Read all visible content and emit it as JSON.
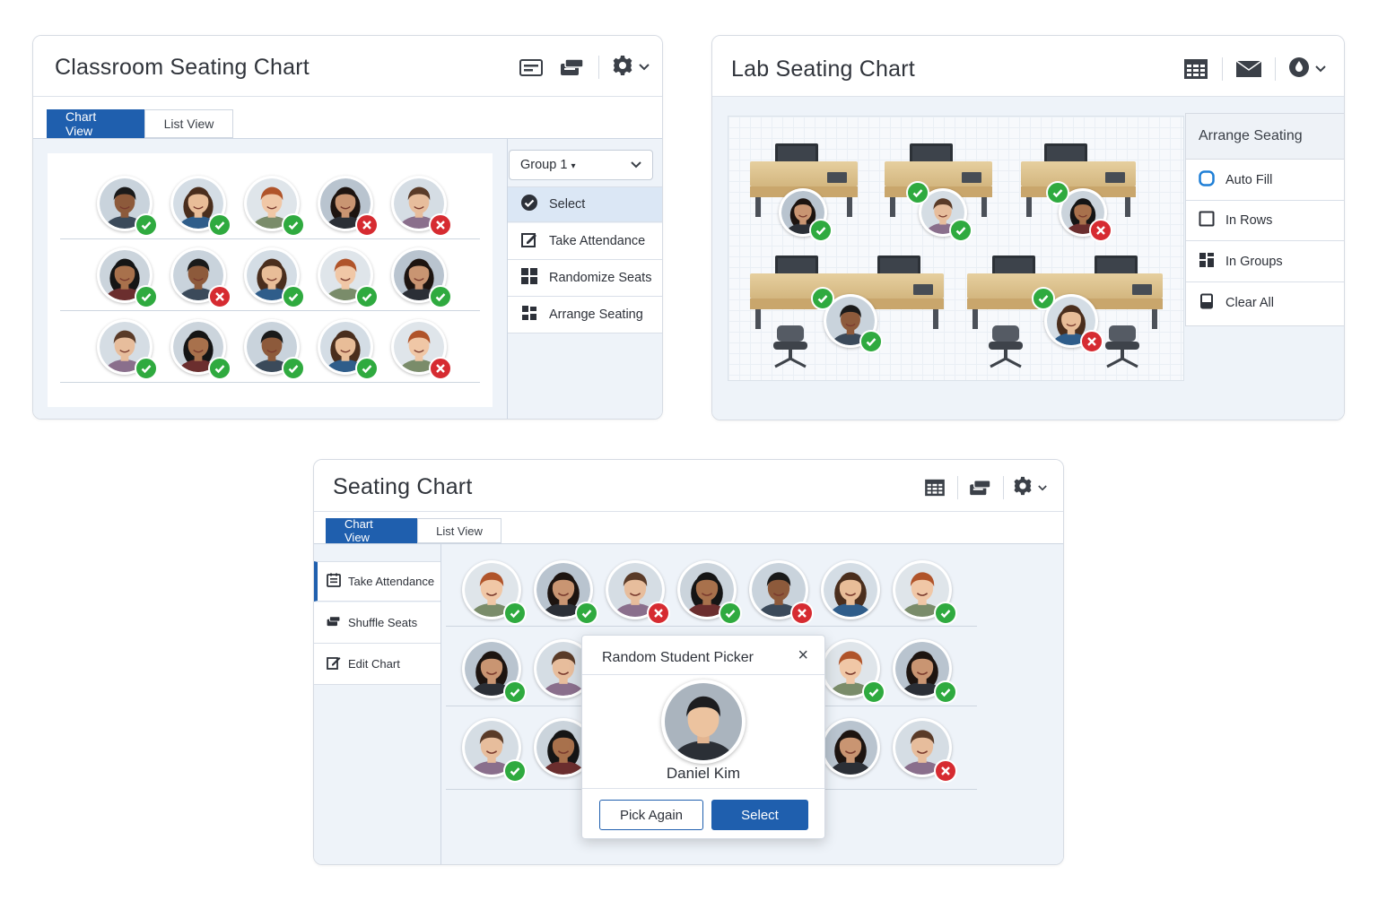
{
  "classroom": {
    "title": "Classroom Seating Chart",
    "icons": [
      "seating-chart-icon",
      "shuffle-icon",
      "gear-icon",
      "chevron-down-icon"
    ],
    "tabs": [
      "Chart View",
      "List View"
    ],
    "active_tab": "Chart View",
    "dropdown": "Group 1",
    "menu": [
      {
        "label": "Select",
        "icon": "check-circle-icon"
      },
      {
        "label": "Take Attendance",
        "icon": "attendance-edit-icon"
      },
      {
        "label": "Randomize Seats",
        "icon": "grid-icon"
      },
      {
        "label": "Arrange Seating",
        "icon": "arrange-icon"
      }
    ],
    "seats": [
      [
        "ok",
        "ok",
        "ok",
        "no",
        "no"
      ],
      [
        "ok",
        "no",
        "ok",
        "ok",
        "ok"
      ],
      [
        "ok",
        "ok",
        "ok",
        "ok",
        "no"
      ]
    ]
  },
  "lab": {
    "title": "Lab Seating Chart",
    "icons": [
      "table-icon",
      "mail-icon",
      "drop-icon",
      "chevron-down-icon"
    ],
    "arrange": {
      "heading": "Arrange Seating",
      "options": [
        {
          "label": "Auto Fill",
          "icon": "radio-icon"
        },
        {
          "label": "In Rows",
          "icon": "checkbox-icon"
        },
        {
          "label": "In Groups",
          "icon": "groups-icon"
        },
        {
          "label": "Clear All",
          "icon": "clear-icon"
        }
      ]
    },
    "stations_top": [
      "ok",
      "ok",
      "no"
    ],
    "stations_top_extra_ok": [
      false,
      true,
      true
    ],
    "stations_bottom": [
      "ok",
      "no"
    ],
    "stations_bottom_extra_ok": [
      true,
      true
    ]
  },
  "seating": {
    "title": "Seating Chart",
    "icons": [
      "table-icon",
      "shuffle-icon",
      "gear-icon",
      "chevron-down-icon"
    ],
    "tabs": [
      "Chart View",
      "List View"
    ],
    "active_tab": "Chart View",
    "side_menu": [
      {
        "label": "Take Attendance",
        "icon": "attendance-icon"
      },
      {
        "label": "Shuffle Seats",
        "icon": "shuffle-icon"
      },
      {
        "label": "Edit Chart",
        "icon": "edit-icon"
      }
    ],
    "seats": [
      [
        "ok",
        "ok",
        "no",
        "ok",
        "no",
        "none",
        "ok"
      ],
      [
        "ok",
        "none",
        "hidden",
        "hidden",
        "hidden",
        "ok",
        "ok"
      ],
      [
        "ok",
        "none",
        "hidden",
        "hidden",
        "hidden",
        "none",
        "no"
      ]
    ],
    "picker": {
      "title": "Random Student Picker",
      "student": "Daniel Kim",
      "pick_again": "Pick Again",
      "select": "Select"
    }
  },
  "colors": {
    "accent": "#1f5fae",
    "ok": "#2faa3f",
    "no": "#d62b31"
  }
}
